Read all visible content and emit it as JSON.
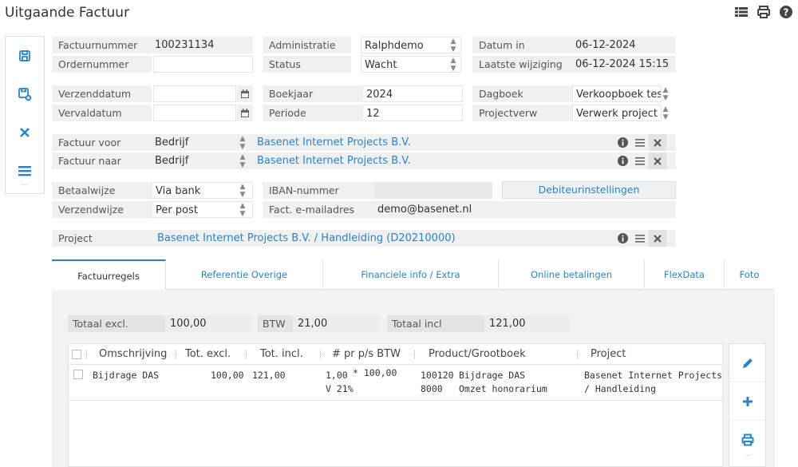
{
  "page": {
    "title": "Uitgaande Factuur"
  },
  "header_icons": [
    "list-icon",
    "print-icon",
    "help-icon"
  ],
  "sidebar": {
    "items": [
      "save-icon",
      "save-close-icon",
      "close-icon",
      "menu-icon"
    ],
    "more": "..."
  },
  "form": {
    "factuurnummer": {
      "label": "Factuurnummer",
      "value": "100231134"
    },
    "ordernummer": {
      "label": "Ordernummer",
      "value": ""
    },
    "administratie": {
      "label": "Administratie",
      "value": "Ralphdemo"
    },
    "status": {
      "label": "Status",
      "value": "Wacht"
    },
    "datum_in": {
      "label": "Datum in",
      "value": "06-12-2024"
    },
    "laatste_wijziging": {
      "label": "Laatste wijziging",
      "value": "06-12-2024 15:15"
    },
    "verzenddatum": {
      "label": "Verzenddatum",
      "value": ""
    },
    "vervaldatum": {
      "label": "Vervaldatum",
      "value": ""
    },
    "boekjaar": {
      "label": "Boekjaar",
      "value": "2024"
    },
    "periode": {
      "label": "Periode",
      "value": "12"
    },
    "dagboek": {
      "label": "Dagboek",
      "value": "Verkoopboek tes"
    },
    "projectverw": {
      "label": "Projectverw",
      "value": "Verwerk project"
    },
    "factuur_voor": {
      "label": "Factuur voor",
      "type": "Bedrijf",
      "value": "Basenet Internet Projects B.V."
    },
    "factuur_naar": {
      "label": "Factuur naar",
      "type": "Bedrijf",
      "value": "Basenet Internet Projects B.V."
    },
    "betaalwijze": {
      "label": "Betaalwijze",
      "value": "Via bank"
    },
    "verzendwijze": {
      "label": "Verzendwijze",
      "value": "Per post"
    },
    "iban": {
      "label": "IBAN-nummer",
      "value": ""
    },
    "email": {
      "label": "Fact. e-mailadres",
      "value": "demo@basenet.nl"
    },
    "debiteur_button": "Debiteurinstellingen",
    "project": {
      "label": "Project",
      "value": "Basenet Internet Projects B.V. / Handleiding  (D20210000)"
    }
  },
  "tabs": [
    {
      "label": "Factuurregels",
      "active": true
    },
    {
      "label": "Referentie Overige",
      "active": false
    },
    {
      "label": "Financiele info / Extra",
      "active": false
    },
    {
      "label": "Online betalingen",
      "active": false
    },
    {
      "label": "FlexData",
      "active": false
    },
    {
      "label": "Foto",
      "active": false
    }
  ],
  "totals": {
    "excl_label": "Totaal excl.",
    "excl_value": "100,00",
    "btw_label": "BTW",
    "btw_value": "21,00",
    "incl_label": "Totaal incl",
    "incl_value": "121,00"
  },
  "table": {
    "columns": [
      "Omschrijving",
      "Tot. excl.",
      "Tot. incl.",
      "# pr p/s BTW",
      "Product/Grootboek",
      "Project"
    ],
    "rows": [
      {
        "omschrijving": "Bijdrage DAS",
        "tot_excl": "100,00",
        "tot_incl": "121,00",
        "aantal": "1,00",
        "prijs": "* 100,00",
        "btw": "V 21%",
        "product_code": "100120",
        "product_name": "Bijdrage DAS",
        "grootboek_code": "8000",
        "grootboek_name": "Omzet honorarium",
        "project_line1": "Basenet Internet Projects B.V.",
        "project_line2": "/ Handleiding"
      }
    ]
  },
  "row_actions": [
    "edit-icon",
    "add-icon",
    "print-icon"
  ],
  "colors": {
    "accent": "#2b83c6",
    "label_bg": "#f0f0f0",
    "panel_bg": "#f2f2f2"
  }
}
